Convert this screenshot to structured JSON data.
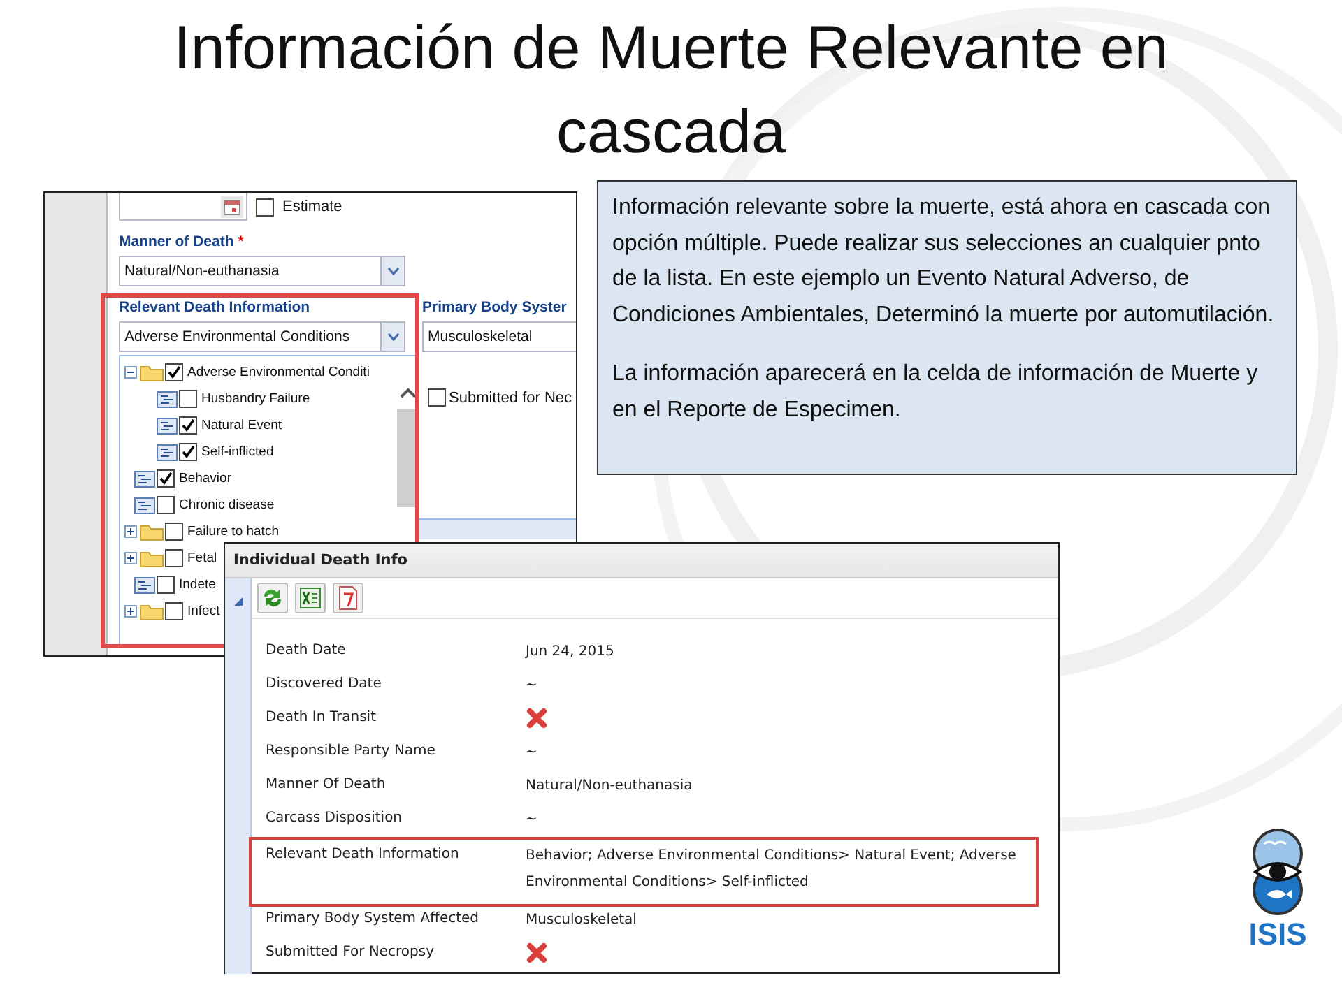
{
  "title": "Información de Muerte Relevante en cascada",
  "note": {
    "paragraphs": [
      "Información relevante sobre la muerte, está ahora en cascada con opción múltiple. Puede realizar sus selecciones an cualquier pnto de la lista.  En este ejemplo un Evento Natural Adverso, de Condiciones Ambientales, Determinó la muerte por automutilación.",
      "La información aparecerá en la celda de información de Muerte y en el Reporte de Especimen."
    ]
  },
  "form": {
    "estimate": {
      "label": "Estimate",
      "checked": false
    },
    "manner_of_death": {
      "label": "Manner of Death",
      "required_mark": "*",
      "value": "Natural/Non-euthanasia"
    },
    "relevant_death_information": {
      "label": "Relevant Death Information",
      "value": "Adverse Environmental Conditions",
      "tree": [
        {
          "kind": "folder",
          "label": "Adverse Environmental Conditi",
          "checked": true,
          "expanded": true,
          "children": [
            {
              "kind": "leaf",
              "label": "Husbandry Failure",
              "checked": false
            },
            {
              "kind": "leaf",
              "label": "Natural Event",
              "checked": true
            },
            {
              "kind": "leaf",
              "label": "Self-inflicted",
              "checked": true
            }
          ]
        },
        {
          "kind": "leaf",
          "label": "Behavior",
          "checked": true
        },
        {
          "kind": "leaf",
          "label": "Chronic disease",
          "checked": false
        },
        {
          "kind": "folder",
          "label": "Failure to hatch",
          "checked": false,
          "expanded": false
        },
        {
          "kind": "folder",
          "label": "Fetal",
          "checked": false,
          "expanded": false
        },
        {
          "kind": "leaf",
          "label": "Indete",
          "checked": false
        },
        {
          "kind": "folder",
          "label": "Infect",
          "checked": false,
          "expanded": false
        }
      ]
    },
    "primary_body_system": {
      "label": "Primary Body Syster",
      "value": "Musculoskeletal"
    },
    "submitted": {
      "label": "Submitted for Nec",
      "checked": false
    }
  },
  "detail": {
    "title": "Individual Death Info",
    "rows": [
      {
        "label": "Death Date",
        "kind": "text",
        "value": "Jun 24, 2015"
      },
      {
        "label": "Discovered Date",
        "kind": "text",
        "value": "~"
      },
      {
        "label": "Death In Transit",
        "kind": "cross"
      },
      {
        "label": "Responsible Party Name",
        "kind": "text",
        "value": "~"
      },
      {
        "label": "Manner Of Death",
        "kind": "text",
        "value": "Natural/Non-euthanasia"
      },
      {
        "label": "Carcass Disposition",
        "kind": "text",
        "value": "~"
      },
      {
        "label": "Relevant Death Information",
        "kind": "text",
        "value": "Behavior; Adverse Environmental Conditions> Natural Event; Adverse Environmental Conditions> Self-inflicted",
        "highlighted": true
      },
      {
        "label": "Primary Body System Affected",
        "kind": "text",
        "value": "Musculoskeletal"
      },
      {
        "label": "Submitted For Necropsy",
        "kind": "cross"
      }
    ]
  },
  "logo": {
    "text": "ISIS"
  }
}
